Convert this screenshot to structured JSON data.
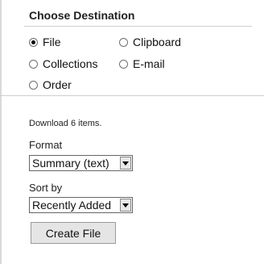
{
  "destination": {
    "title": "Choose Destination",
    "options": [
      {
        "label": "File",
        "checked": true
      },
      {
        "label": "Clipboard",
        "checked": false
      },
      {
        "label": "Collections",
        "checked": false
      },
      {
        "label": "E-mail",
        "checked": false
      },
      {
        "label": "Order",
        "checked": false
      }
    ]
  },
  "download": {
    "count_text": "Download 6 items.",
    "format_label": "Format",
    "format_value": "Summary (text)",
    "sort_label": "Sort by",
    "sort_value": "Recently Added",
    "create_button": "Create File"
  }
}
